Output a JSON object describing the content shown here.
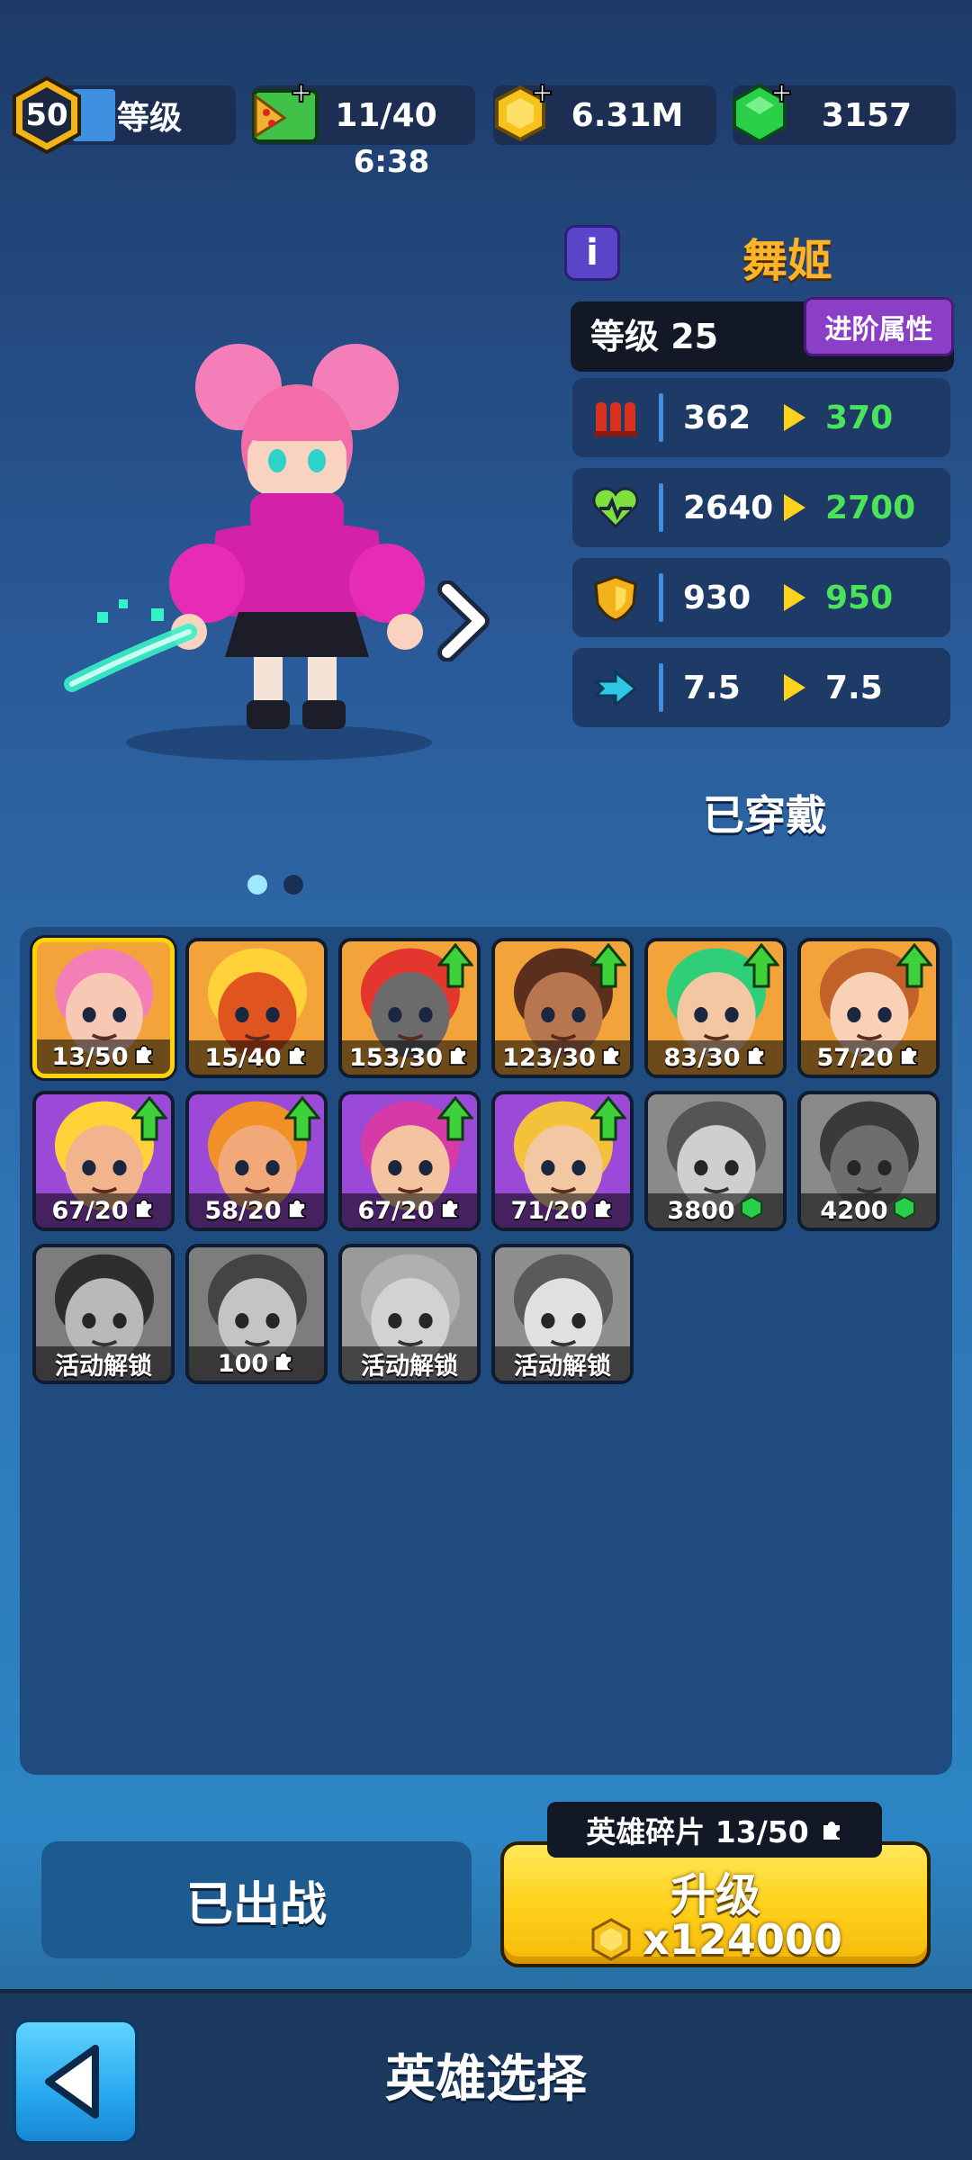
{
  "topbar": {
    "player_level": "50",
    "level_label": "等级",
    "energy": "11/40",
    "energy_timer": "6:38",
    "coins": "6.31M",
    "gems": "3157"
  },
  "hero": {
    "name": "舞姬",
    "level_text": "等级 25",
    "advanced_label": "进阶属性",
    "equipped_label": "已穿戴",
    "page_indicator": {
      "total": 2,
      "active": 1
    },
    "stats": [
      {
        "icon": "ammo-icon",
        "current": "362",
        "next": "370"
      },
      {
        "icon": "heart-icon",
        "current": "2640",
        "next": "2700"
      },
      {
        "icon": "shield-icon",
        "current": "930",
        "next": "950"
      },
      {
        "icon": "speed-icon",
        "current": "7.5",
        "next": "7.5"
      }
    ]
  },
  "roster": [
    {
      "id": "dancer",
      "label": "13/50",
      "cost": "piece",
      "upgrade": false,
      "selected": true,
      "bg": "#f2a43a",
      "face": "#f7c9b5",
      "hair": "#f47fb8"
    },
    {
      "id": "robot",
      "label": "15/40",
      "cost": "piece",
      "upgrade": false,
      "selected": false,
      "bg": "#f2a43a",
      "face": "#e0551f",
      "hair": "#ffd23a"
    },
    {
      "id": "skull",
      "label": "153/30",
      "cost": "piece",
      "upgrade": true,
      "selected": false,
      "bg": "#f2a43a",
      "face": "#6b6b6b",
      "hair": "#e2362e"
    },
    {
      "id": "braids",
      "label": "123/30",
      "cost": "piece",
      "upgrade": true,
      "selected": false,
      "bg": "#f2a43a",
      "face": "#b8764e",
      "hair": "#5a2f1c"
    },
    {
      "id": "visor",
      "label": "83/30",
      "cost": "piece",
      "upgrade": true,
      "selected": false,
      "bg": "#f2a43a",
      "face": "#f4c7a3",
      "hair": "#2fcf7a"
    },
    {
      "id": "cowgirl",
      "label": "57/20",
      "cost": "piece",
      "upgrade": true,
      "selected": false,
      "bg": "#f2a43a",
      "face": "#f9d2b5",
      "hair": "#c2612a"
    },
    {
      "id": "bandana",
      "label": "67/20",
      "cost": "piece",
      "upgrade": true,
      "selected": false,
      "bg": "#9a4ad6",
      "face": "#f1b48c",
      "hair": "#ffd23a"
    },
    {
      "id": "bruiser",
      "label": "58/20",
      "cost": "piece",
      "upgrade": true,
      "selected": false,
      "bg": "#9a4ad6",
      "face": "#f1a97a",
      "hair": "#f09026"
    },
    {
      "id": "punk",
      "label": "67/20",
      "cost": "piece",
      "upgrade": true,
      "selected": false,
      "bg": "#9a4ad6",
      "face": "#f4c4a0",
      "hair": "#d63aa6"
    },
    {
      "id": "goggles",
      "label": "71/20",
      "cost": "piece",
      "upgrade": true,
      "selected": false,
      "bg": "#9a4ad6",
      "face": "#f4c7a3",
      "hair": "#f4c23a"
    },
    {
      "id": "headset",
      "label": "3800",
      "cost": "gem",
      "upgrade": false,
      "selected": false,
      "bg": "#8a8a8a",
      "face": "#cfcfcf",
      "hair": "#555555",
      "locked": true
    },
    {
      "id": "mask",
      "label": "4200",
      "cost": "gem",
      "upgrade": false,
      "selected": false,
      "bg": "#8a8a8a",
      "face": "#6e6e6e",
      "hair": "#3a3a3a",
      "locked": true
    },
    {
      "id": "hat",
      "label": "活动解锁",
      "cost": "none",
      "upgrade": false,
      "selected": false,
      "bg": "#7d7d7d",
      "face": "#b9b9b9",
      "hair": "#2e2e2e",
      "locked": true
    },
    {
      "id": "warrior",
      "label": "100",
      "cost": "piece",
      "upgrade": false,
      "selected": false,
      "bg": "#7d7d7d",
      "face": "#c4c4c4",
      "hair": "#444444",
      "locked": true
    },
    {
      "id": "lady",
      "label": "活动解锁",
      "cost": "none",
      "upgrade": false,
      "selected": false,
      "bg": "#9a9a9a",
      "face": "#d2d2d2",
      "hair": "#b0b0b0",
      "locked": true
    },
    {
      "id": "helmet",
      "label": "活动解锁",
      "cost": "none",
      "upgrade": false,
      "selected": false,
      "bg": "#8f8f8f",
      "face": "#e0e0e0",
      "hair": "#5a5a5a",
      "locked": true
    }
  ],
  "actions": {
    "deployed_label": "已出战",
    "shards_text": "英雄碎片 13/50",
    "upgrade_label": "升级",
    "upgrade_cost": "x124000"
  },
  "footer": {
    "title": "英雄选择"
  },
  "colors": {
    "stat_next": "#4be35a",
    "hero_name": "#ffb427",
    "accent_blue": "#3f8fe6"
  }
}
